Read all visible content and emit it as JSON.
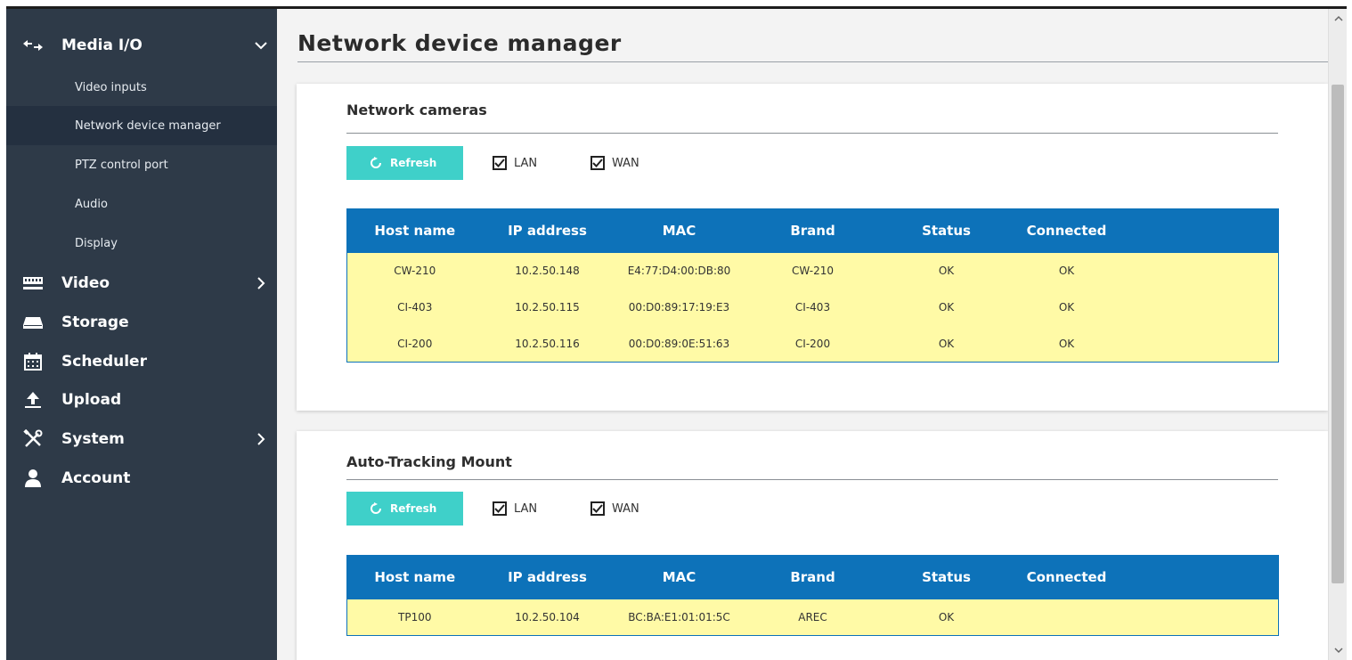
{
  "sidebar": {
    "media_io": {
      "label": "Media I/O",
      "icon": "arrows-icon",
      "expanded": true
    },
    "subitems": [
      {
        "label": "Video inputs",
        "active": false
      },
      {
        "label": "Network device manager",
        "active": true
      },
      {
        "label": "PTZ control port",
        "active": false
      },
      {
        "label": "Audio",
        "active": false
      },
      {
        "label": "Display",
        "active": false
      }
    ],
    "items": [
      {
        "label": "Video",
        "icon": "film-icon",
        "has_chevron": true
      },
      {
        "label": "Storage",
        "icon": "drive-icon",
        "has_chevron": false
      },
      {
        "label": "Scheduler",
        "icon": "calendar-icon",
        "has_chevron": false
      },
      {
        "label": "Upload",
        "icon": "upload-icon",
        "has_chevron": false
      },
      {
        "label": "System",
        "icon": "tools-icon",
        "has_chevron": true
      },
      {
        "label": "Account",
        "icon": "user-icon",
        "has_chevron": false
      }
    ]
  },
  "page": {
    "title": "Network device manager"
  },
  "network_cameras": {
    "title": "Network cameras",
    "refresh_label": "Refresh",
    "lan_label": "LAN",
    "lan_checked": true,
    "wan_label": "WAN",
    "wan_checked": true,
    "columns": [
      "Host name",
      "IP address",
      "MAC",
      "Brand",
      "Status",
      "Connected"
    ],
    "rows": [
      [
        "CW-210",
        "10.2.50.148",
        "E4:77:D4:00:DB:80",
        "CW-210",
        "OK",
        "OK"
      ],
      [
        "CI-403",
        "10.2.50.115",
        "00:D0:89:17:19:E3",
        "CI-403",
        "OK",
        "OK"
      ],
      [
        "CI-200",
        "10.2.50.116",
        "00:D0:89:0E:51:63",
        "CI-200",
        "OK",
        "OK"
      ]
    ]
  },
  "auto_tracking": {
    "title": "Auto-Tracking Mount",
    "refresh_label": "Refresh",
    "lan_label": "LAN",
    "lan_checked": true,
    "wan_label": "WAN",
    "wan_checked": true,
    "columns": [
      "Host name",
      "IP address",
      "MAC",
      "Brand",
      "Status",
      "Connected"
    ],
    "rows": [
      [
        "TP100",
        "10.2.50.104",
        "BC:BA:E1:01:01:5C",
        "AREC",
        "OK",
        ""
      ]
    ]
  },
  "colors": {
    "sidebar_bg": "#2e3a48",
    "accent_teal": "#3fd0c9",
    "table_header": "#0d72b9",
    "row_yellow": "#fffaa6"
  }
}
